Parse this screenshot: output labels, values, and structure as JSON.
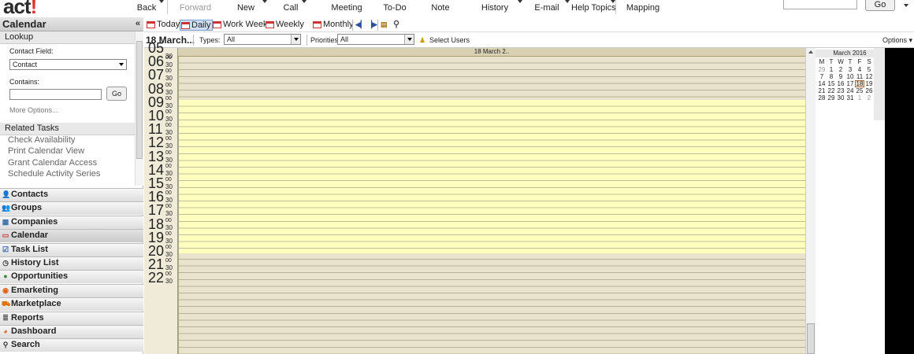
{
  "app": {
    "logo_main": "act",
    "logo_accent": "!"
  },
  "toolbar": {
    "items": [
      {
        "label": "Back",
        "disabled": false
      },
      {
        "label": "Forward",
        "disabled": true
      },
      {
        "label": "New",
        "disabled": false
      },
      {
        "label": "Call",
        "disabled": false
      },
      {
        "label": "Meeting",
        "disabled": false
      },
      {
        "label": "To-Do",
        "disabled": false
      },
      {
        "label": "Note",
        "disabled": false
      },
      {
        "label": "History",
        "disabled": false
      },
      {
        "label": "E-mail",
        "disabled": false
      },
      {
        "label": "Help Topics",
        "disabled": false
      },
      {
        "label": "Mapping",
        "disabled": false
      }
    ],
    "go_label": "Go"
  },
  "sidebar": {
    "title": "Calendar",
    "collapse_glyph": "«",
    "lookup": {
      "section_label": "Lookup",
      "contact_field_label": "Contact Field:",
      "contact_field_value": "Contact",
      "contains_label": "Contains:",
      "go_label": "Go",
      "more_options": "More Options..."
    },
    "related_tasks": {
      "section_label": "Related Tasks",
      "items": [
        "Check Availability",
        "Print Calendar View",
        "Grant Calendar Access",
        "Schedule Activity Series"
      ]
    },
    "nav": [
      {
        "label": "Contacts",
        "icon": "person-icon",
        "glyph": "👤",
        "color": "#2a5fa8"
      },
      {
        "label": "Groups",
        "icon": "group-icon",
        "glyph": "👥",
        "color": "#2a5fa8"
      },
      {
        "label": "Companies",
        "icon": "building-icon",
        "glyph": "▦",
        "color": "#3a6fb0"
      },
      {
        "label": "Calendar",
        "icon": "calendar-icon",
        "glyph": "▭",
        "color": "#c33"
      },
      {
        "label": "Task List",
        "icon": "checkbox-icon",
        "glyph": "☑",
        "color": "#2a5fa8"
      },
      {
        "label": "History List",
        "icon": "clock-icon",
        "glyph": "◷",
        "color": "#333"
      },
      {
        "label": "Opportunities",
        "icon": "money-icon",
        "glyph": "●",
        "color": "#3a8a3a"
      },
      {
        "label": "Emarketing",
        "icon": "emarketing-icon",
        "glyph": "◉",
        "color": "#e06010"
      },
      {
        "label": "Marketplace",
        "icon": "cart-icon",
        "glyph": "⛟",
        "color": "#e07010"
      },
      {
        "label": "Reports",
        "icon": "report-icon",
        "glyph": "≣",
        "color": "#555"
      },
      {
        "label": "Dashboard",
        "icon": "dashboard-icon",
        "glyph": "◕",
        "color": "#e06010"
      },
      {
        "label": "Search",
        "icon": "search-icon",
        "glyph": "⚲",
        "color": "#333"
      }
    ],
    "selected_nav": "Calendar"
  },
  "calendar_toolbar": {
    "buttons": [
      "Today",
      "Daily",
      "Work Week",
      "Weekly",
      "Monthly"
    ],
    "selected": "Daily"
  },
  "filter": {
    "date_title": "18 March...",
    "types_label": "Types:",
    "types_value": "All",
    "priorities_label": "Priorities:",
    "priorities_value": "All",
    "select_users": "Select Users",
    "options": "Options"
  },
  "day_view": {
    "column_header": "18 March 2..",
    "hours": [
      "06",
      "07",
      "08",
      "09",
      "10",
      "11",
      "12",
      "13",
      "14",
      "15",
      "16",
      "17",
      "18",
      "19",
      "20",
      "21",
      "22"
    ],
    "partial_first_hour": "05",
    "minute_labels": [
      "00",
      "30"
    ],
    "colors": {
      "off_hours": "#e9e3ce",
      "work_hours": "#ffffc0",
      "header": "#d9d1b4"
    }
  },
  "mini_calendar": {
    "title": "March 2016",
    "weekdays": [
      "M",
      "T",
      "W",
      "T",
      "F",
      "S"
    ],
    "weeks": [
      [
        {
          "d": "29",
          "o": true
        },
        {
          "d": "1"
        },
        {
          "d": "2"
        },
        {
          "d": "3"
        },
        {
          "d": "4"
        },
        {
          "d": "5"
        }
      ],
      [
        {
          "d": "7"
        },
        {
          "d": "8"
        },
        {
          "d": "9"
        },
        {
          "d": "10"
        },
        {
          "d": "11"
        },
        {
          "d": "12"
        }
      ],
      [
        {
          "d": "14"
        },
        {
          "d": "15"
        },
        {
          "d": "16"
        },
        {
          "d": "17"
        },
        {
          "d": "18",
          "today": true
        },
        {
          "d": "19"
        }
      ],
      [
        {
          "d": "21"
        },
        {
          "d": "22"
        },
        {
          "d": "23"
        },
        {
          "d": "24"
        },
        {
          "d": "25"
        },
        {
          "d": "26"
        }
      ],
      [
        {
          "d": "28"
        },
        {
          "d": "29"
        },
        {
          "d": "30"
        },
        {
          "d": "31"
        },
        {
          "d": "1",
          "o": true
        },
        {
          "d": "2",
          "o": true
        }
      ]
    ]
  }
}
